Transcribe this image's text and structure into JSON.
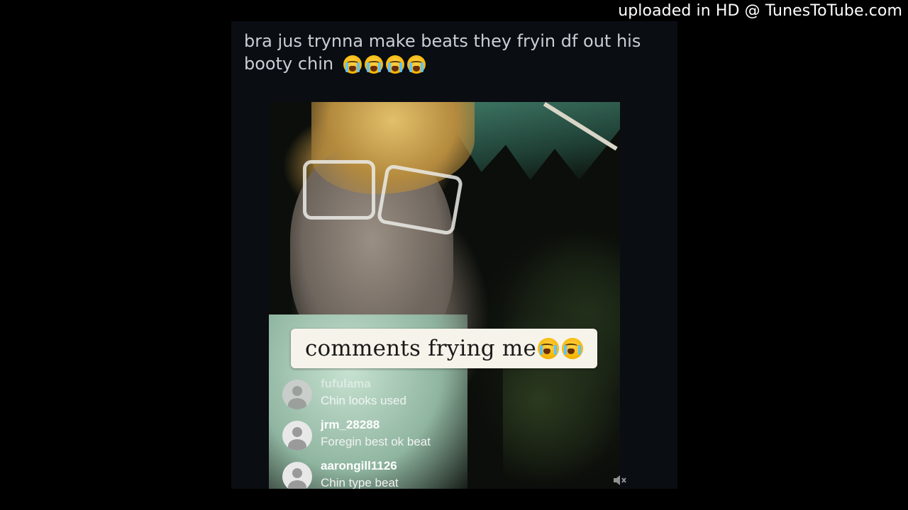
{
  "watermark": {
    "text": "uploaded in HD @ TunesToTube.com"
  },
  "post": {
    "caption": "bra jus trynna make beats they fryin df out his booty chin",
    "caption_emoji": [
      "loudly-crying-face",
      "loudly-crying-face",
      "loudly-crying-face",
      "loudly-crying-face"
    ]
  },
  "video": {
    "overlay_text": "comments frying me",
    "overlay_emoji": [
      "loudly-crying-face",
      "loudly-crying-face"
    ],
    "comments": [
      {
        "username": "fufulama",
        "text": "Chin looks used"
      },
      {
        "username": "jrm_28288",
        "text": "Foregin best ok beat"
      },
      {
        "username": "aarongill1126",
        "text": "Chin type beat"
      }
    ],
    "mute_icon": "speaker-muted-icon"
  },
  "colors": {
    "background": "#000000",
    "card_background": "#0a0d12",
    "caption_text": "#c9cfd6",
    "overlay_background": "#f6f3ea"
  }
}
